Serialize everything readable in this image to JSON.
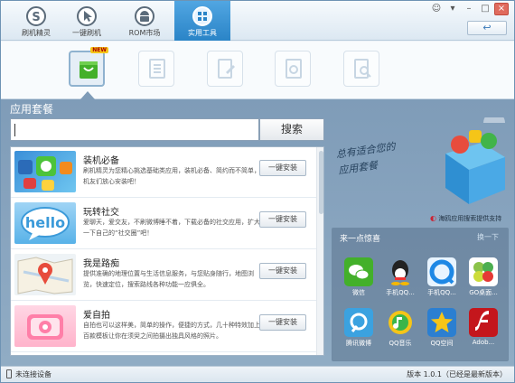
{
  "nav": {
    "tabs": [
      {
        "label": "刷机精灵",
        "icon": "s-logo-icon"
      },
      {
        "label": "一键刷机",
        "icon": "cursor-icon"
      },
      {
        "label": "ROM市场",
        "icon": "android-icon"
      },
      {
        "label": "实用工具",
        "icon": "grid-icon",
        "active": true
      }
    ],
    "window_buttons": [
      "feedback-icon",
      "menu-icon",
      "minimize-icon",
      "maximize-icon",
      "close-icon"
    ],
    "back_label": "↩"
  },
  "subtools": [
    {
      "icon": "bag-icon",
      "badge": "NEW",
      "active": true
    },
    {
      "icon": "document-icon"
    },
    {
      "icon": "edit-doc-icon"
    },
    {
      "icon": "gear-doc-icon"
    },
    {
      "icon": "search-doc-icon"
    }
  ],
  "section_title": "应用套餐",
  "search": {
    "value": "",
    "button_label": "搜索"
  },
  "packages": [
    {
      "title": "装机必备",
      "desc": "刷机精灵为您精心挑选基础类应用，装机必备、简约而不简单，机友们放心安装吧！",
      "button": "一键安装"
    },
    {
      "title": "玩转社交",
      "desc": "爱聊天，爱交友，不刷微博睡不着，下载必备的社交应用，扩大一下自己的“社交圈”吧！",
      "button": "一键安装"
    },
    {
      "title": "我是路痴",
      "desc": "提供准确的地理位置与生活信息服务，与您贴身随行，地图浏览，快速定位，搜索路线各种功能一应俱全。",
      "button": "一键安装"
    },
    {
      "title": "爱自拍",
      "desc": "自拍也可以这样美，简单的操作，便捷的方式，几十种特效加上百款模板让你在须臾之间拍摄出独具风格的照片。",
      "button": "一键安装"
    }
  ],
  "promo": {
    "text": "总有适合您的\n应用套餐",
    "provider": "海鸥应用搜索提供支持"
  },
  "guess": {
    "title": "来一点惊喜",
    "more": "换一下",
    "apps": [
      {
        "name": "微信",
        "icon": "wechat-icon"
      },
      {
        "name": "手机QQ...",
        "icon": "qq-icon"
      },
      {
        "name": "手机QQ...",
        "icon": "qq-browser-icon"
      },
      {
        "name": "GO桌面...",
        "icon": "go-launcher-icon"
      },
      {
        "name": "腾讯微博",
        "icon": "tencent-weibo-icon"
      },
      {
        "name": "QQ音乐",
        "icon": "qq-music-icon"
      },
      {
        "name": "QQ空间",
        "icon": "qzone-icon"
      },
      {
        "name": "Adob...",
        "icon": "adobe-flash-icon"
      }
    ]
  },
  "status": {
    "device": "未连接设备",
    "version": "版本 1.0.1（已经是最新版本）"
  }
}
